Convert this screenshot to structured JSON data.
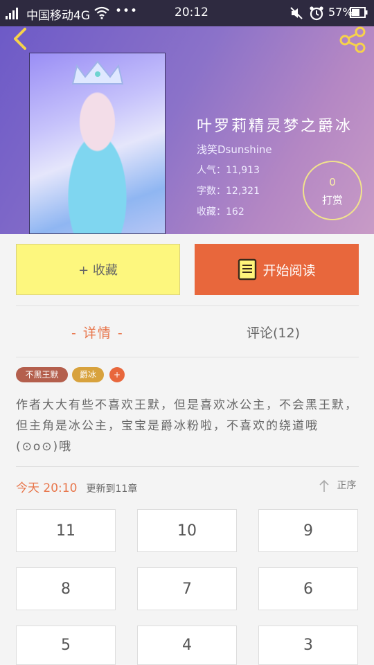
{
  "status_bar": {
    "carrier": "中国移动4G",
    "dots": "•••",
    "time": "20:12",
    "battery": "57%"
  },
  "book": {
    "title": "叶罗莉精灵梦之爵冰",
    "author": "浅笑Dsunshine",
    "popularity": "人气：11,913",
    "word_count": "字数：12,321",
    "favorites": "收藏：162"
  },
  "tip": {
    "count": "0",
    "label": "打赏"
  },
  "actions": {
    "favorite": "+ 收藏",
    "read": "开始阅读"
  },
  "tabs": {
    "detail": "- 详情 -",
    "comments": "评论(12)"
  },
  "tags": [
    "不黑王默",
    "爵冰",
    "+"
  ],
  "description": "作者大大有些不喜欢王默，但是喜欢冰公主，不会黑王默，但主角是冰公主，宝宝是爵冰粉啦，不喜欢的绕道哦(⊙o⊙)哦",
  "update": {
    "today": "今天 20:10",
    "text": "更新到11章"
  },
  "sort_label": "正序",
  "chapters": [
    "11",
    "10",
    "9",
    "8",
    "7",
    "6",
    "5",
    "4",
    "3"
  ],
  "colors": {
    "accent": "#e8673c",
    "favorite_bg": "#fdf77e",
    "tag_brown": "#b45f4d",
    "tag_gold": "#d8a23d"
  }
}
